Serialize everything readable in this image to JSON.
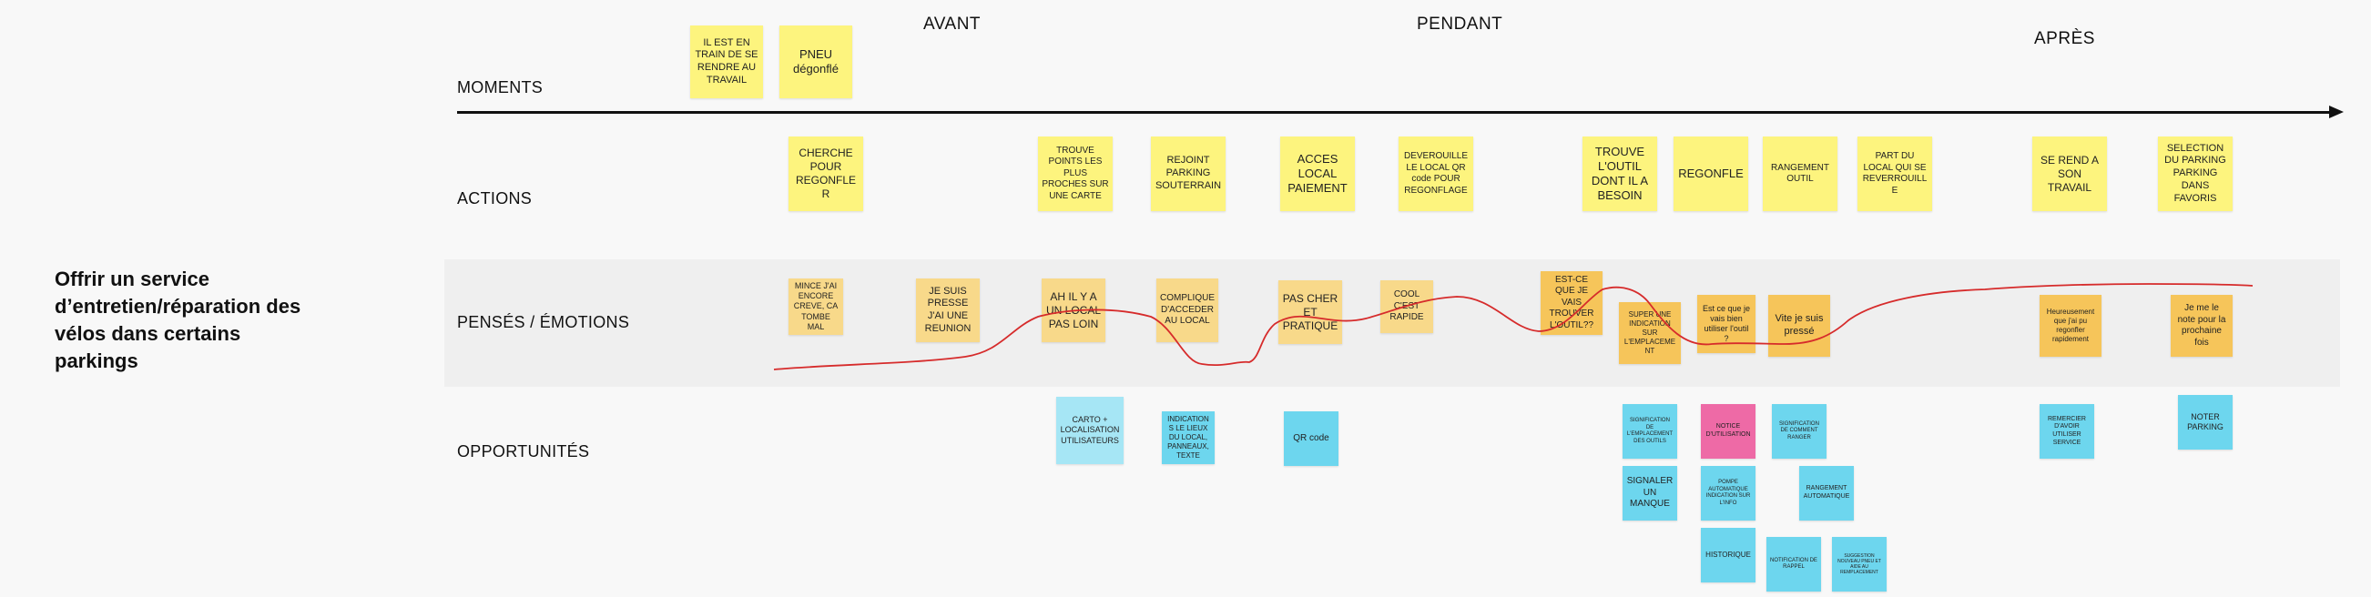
{
  "board": {
    "title": "Offrir un service d’entretien/réparation des vélos dans certains parkings",
    "phases": [
      "AVANT",
      "PENDANT",
      "APRÈS"
    ],
    "rows": {
      "moments": "MOMENTS",
      "actions": "ACTIONS",
      "pensees": "PENSÉS / ÉMOTIONS",
      "opportunites": "OPPORTUNITÉS"
    }
  },
  "colors": {
    "moment_note": "#fdf47e",
    "action_note": "#fdf47e",
    "thought_note": "#f8d98a",
    "thought_note_strong": "#f6c55a",
    "opportunity_note": "#6dd6ee",
    "opportunity_note_light": "#a6e6f5",
    "opportunity_note_pink": "#ee6aa6",
    "emotion_curve": "#d62b2b"
  },
  "notes": {
    "moments": [
      "IL EST EN TRAIN DE SE RENDRE AU TRAVAIL",
      "PNEU dégonflé"
    ],
    "actions": [
      "CHERCHE POUR REGONFLER",
      "TROUVE POINTS LES PLUS PROCHES SUR UNE CARTE",
      "REJOINT PARKING SOUTERRAIN",
      "ACCES LOCAL PAIEMENT",
      "DEVEROUILLE LE LOCAL QR code POUR REGONFLAGE",
      "TROUVE L'OUTIL DONT IL A BESOIN",
      "REGONFLE",
      "RANGEMENT OUTIL",
      "PART DU LOCAL QUI SE REVERROUILLE",
      "SE REND A SON TRAVAIL",
      "SELECTION DU PARKING PARKING DANS FAVORIS"
    ],
    "thoughts": [
      "MINCE J'AI ENCORE CREVE, CA TOMBE MAL",
      "JE SUIS PRESSE J'AI UNE REUNION",
      "AH IL Y A UN LOCAL PAS LOIN",
      "COMPLIQUE D'ACCEDER AU LOCAL",
      "PAS CHER ET PRATIQUE",
      "COOL C'EST RAPIDE",
      "EST-CE QUE JE VAIS TROUVER L'OUTIL??",
      "SUPER UNE INDICATION SUR L'EMPLACEMENT",
      "Est ce que je vais bien utiliser l'outil ?",
      "Vite je suis pressé",
      "Heureusement que j'ai pu regonfler rapidement",
      "Je me le note pour la prochaine fois"
    ],
    "opportunities": [
      "CARTO + LOCALISATION UTILISATEURS",
      "INDICATIONS LE LIEUX DU LOCAL, PANNEAUX, TEXTE",
      "QR code",
      "SIGNIFICATION DE L'EMPLACEMENT DES OUTILS",
      "NOTICE D'UTILISATION",
      "SIGNIFICATION DE COMMENT RANGER",
      "SIGNALER UN MANQUE",
      "POMPE AUTOMATIQUE INDICATION SUR L'INFO",
      "RANGEMENT AUTOMATIQUE",
      "HISTORIQUE",
      "NOTIFICATION DE RAPPEL",
      "SUGGESTION NOUVEAU PNEU ET AIDE AU REMPLACEMENT",
      "REMERCIER D'AVOIR UTILISER SERVICE",
      "NOTER PARKING"
    ]
  }
}
